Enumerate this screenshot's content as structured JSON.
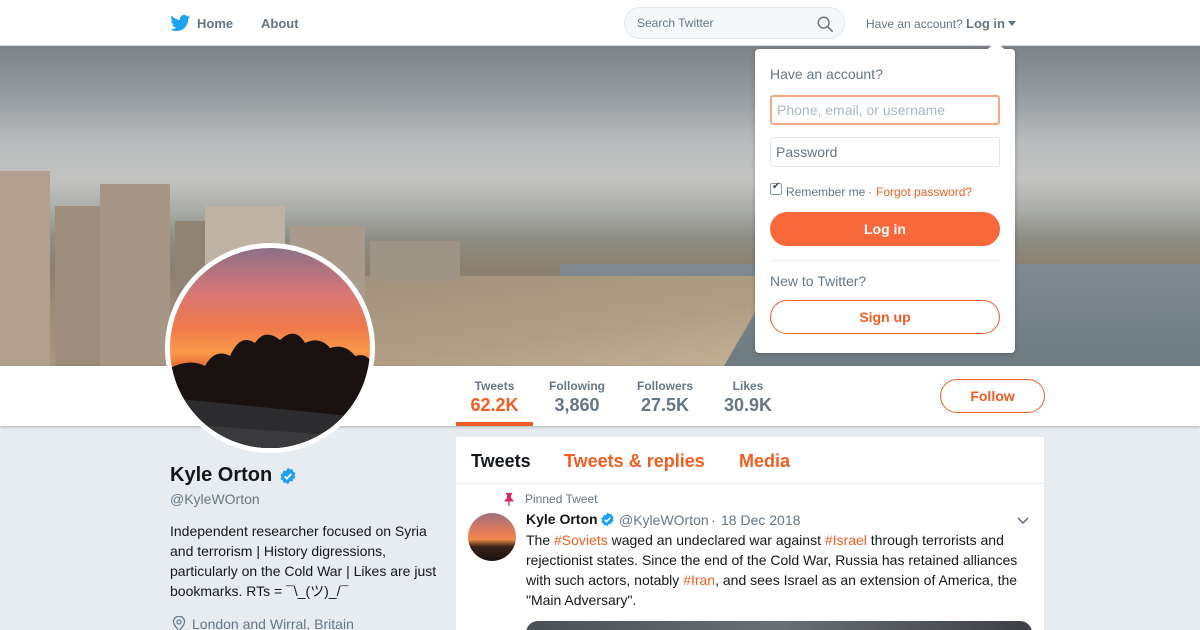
{
  "nav": {
    "home_label": "Home",
    "about_label": "About",
    "search_placeholder": "Search Twitter",
    "have_account": "Have an account?",
    "login_label": "Log in"
  },
  "profile": {
    "name": "Kyle Orton",
    "handle": "@KyleWOrton",
    "bio": "Independent researcher focused on Syria and terrorism | History digressions, particularly on the Cold War | Likes are just bookmarks. RTs = ¯\\_(ツ)_/¯",
    "location": "London and Wirral, Britain",
    "follow_label": "Follow"
  },
  "stats": [
    {
      "label": "Tweets",
      "value": "62.2K",
      "active": true
    },
    {
      "label": "Following",
      "value": "3,860",
      "active": false
    },
    {
      "label": "Followers",
      "value": "27.5K",
      "active": false
    },
    {
      "label": "Likes",
      "value": "30.9K",
      "active": false
    }
  ],
  "timeline": {
    "tabs": [
      "Tweets",
      "Tweets & replies",
      "Media"
    ],
    "active_tab": "Tweets",
    "pinned_label": "Pinned Tweet",
    "tweet": {
      "author": "Kyle Orton",
      "handle": "@KyleWOrton",
      "separator": "·",
      "date": "18 Dec 2018",
      "text_parts": {
        "p1": "The ",
        "h1": "#Soviets",
        "p2": " waged an undeclared war against ",
        "h2": "#Israel",
        "p3": " through terrorists and rejectionist states. Since the end of the Cold War, Russia has retained alliances with such actors, notably ",
        "h3": "#Iran",
        "p4": ", and sees Israel as an extension of America, the \"Main Adversary\"."
      }
    }
  },
  "login_dropdown": {
    "title": "Have an account?",
    "username_placeholder": "Phone, email, or username",
    "password_placeholder": "Password",
    "remember_label": "Remember me",
    "separator": "·",
    "forgot_label": "Forgot password?",
    "login_button": "Log in",
    "new_label": "New to Twitter?",
    "signup_button": "Sign up"
  },
  "colors": {
    "accent": "#f45d22",
    "verified": "#1da1f2",
    "twitter_blue": "#1da1f2"
  }
}
